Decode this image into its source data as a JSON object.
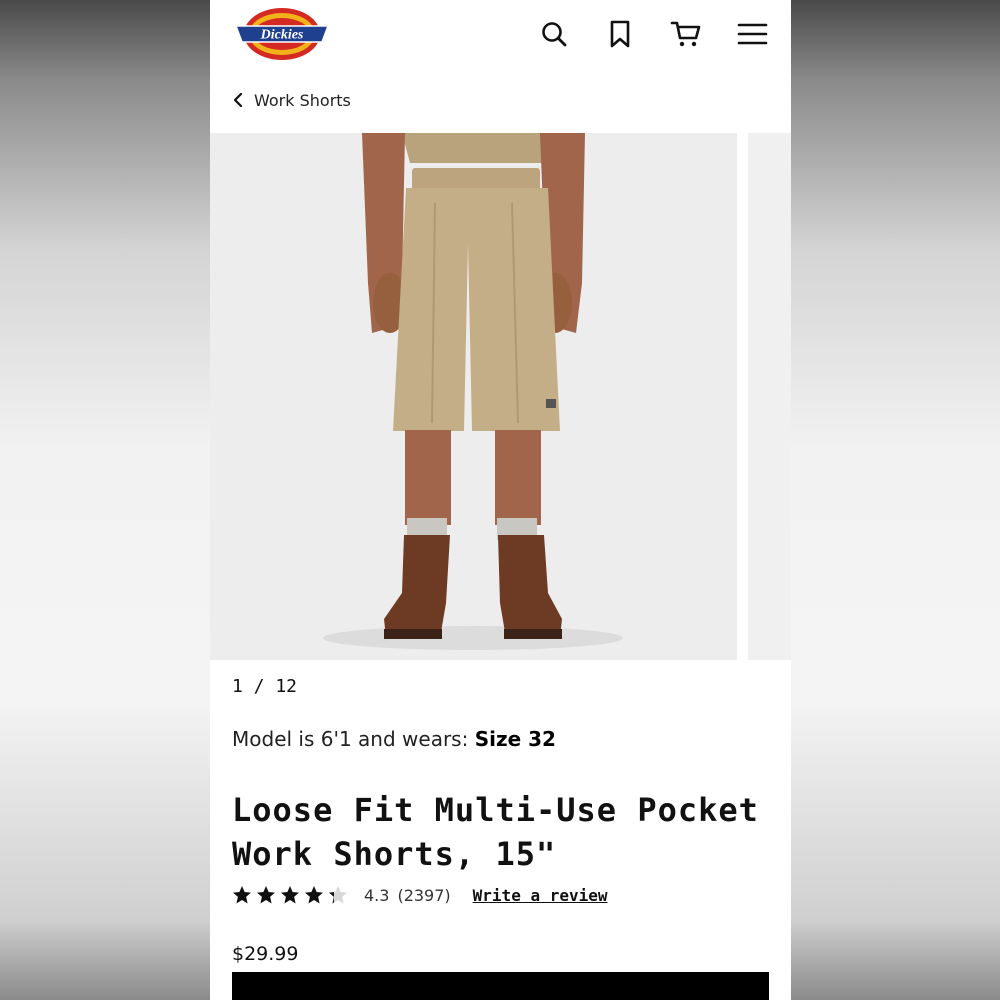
{
  "header": {
    "logo_text": "Dickies",
    "icons": [
      "search-icon",
      "bookmark-icon",
      "cart-icon",
      "menu-icon"
    ]
  },
  "breadcrumb": {
    "label": "Work Shorts"
  },
  "gallery": {
    "counter": "1 / 12"
  },
  "model_info": {
    "prefix": "Model is 6'1 and wears: ",
    "size": "Size 32"
  },
  "product": {
    "title": "Loose Fit Multi-Use Pocket Work Shorts, 15\"",
    "rating_value": 4.3,
    "rating": "4.3",
    "review_count": "(2397)",
    "write_review": "Write a review",
    "price": "$29.99"
  },
  "colors": {
    "accent": "#000000",
    "logo_red": "#d42a23",
    "logo_blue": "#1f3f8f",
    "logo_yellow": "#f2b31a"
  }
}
